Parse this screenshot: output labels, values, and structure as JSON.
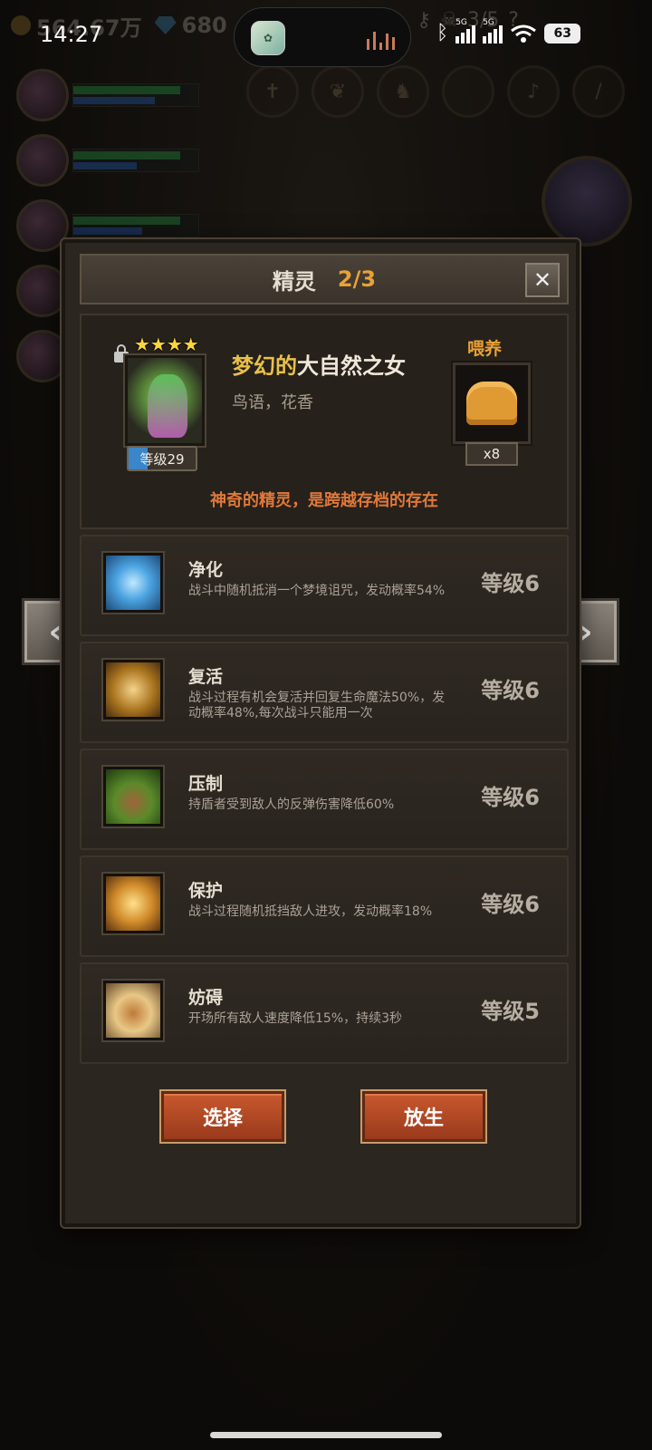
{
  "status_bar": {
    "time": "14:27",
    "battery": "63",
    "network_tag": "5G"
  },
  "background": {
    "gold": "564.67万",
    "gems": "680",
    "dungeon_progress": "3/5"
  },
  "modal": {
    "title": "精灵",
    "count": "2/3",
    "close_label": "✕"
  },
  "hero": {
    "name_part1": "梦幻的",
    "name_part2": "大自然之女",
    "tags": "鸟语，花香",
    "stars": "★★★★",
    "level_label": "等级29",
    "level_progress": 0.28,
    "description": "神奇的精灵，是跨越存档的存在",
    "feed_label": "喂养",
    "feed_count": "x8"
  },
  "skills": [
    {
      "name": "净化",
      "desc": "战斗中随机抵消一个梦境诅咒，发动概率54%",
      "level": "等级6"
    },
    {
      "name": "复活",
      "desc": "战斗过程有机会复活并回复生命魔法50%，发动概率48%,每次战斗只能用一次",
      "level": "等级6"
    },
    {
      "name": "压制",
      "desc": "持盾者受到敌人的反弹伤害降低60%",
      "level": "等级6"
    },
    {
      "name": "保护",
      "desc": "战斗过程随机抵挡敌人进攻，发动概率18%",
      "level": "等级6"
    },
    {
      "name": "妨碍",
      "desc": "开场所有敌人速度降低15%，持续3秒",
      "level": "等级5"
    }
  ],
  "buttons": {
    "select": "选择",
    "release": "放生",
    "prev": "‹",
    "next": "›"
  },
  "colors": {
    "accent_orange": "#e9a237",
    "description_orange": "#e0783a",
    "button_red": "#b4482a",
    "hero_name_gold": "#e8c04a"
  }
}
